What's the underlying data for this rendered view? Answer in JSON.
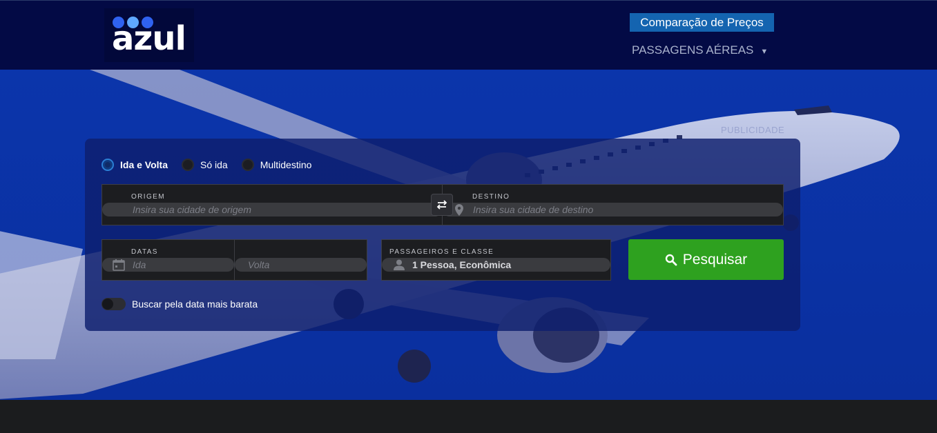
{
  "header": {
    "logo": {
      "text": "azul",
      "dot_colors": [
        "#2f62f0",
        "#5fa8ff",
        "#2f62f0"
      ]
    },
    "compare_label": "Comparação de Preços",
    "nav_label": "PASSAGENS AÉREAS",
    "nav_caret": "▼"
  },
  "hero": {
    "ad_label": "PUBLICIDADE"
  },
  "search": {
    "trip_types": [
      "Ida e Volta",
      "Só ida",
      "Multidestino"
    ],
    "selected_trip": "Ida e Volta",
    "origin": {
      "label": "ORIGEM",
      "placeholder": "Insira sua cidade de origem",
      "icon": "origin-circle-icon"
    },
    "destination": {
      "label": "DESTINO",
      "placeholder": "Insira sua cidade de destino",
      "icon": "map-pin-icon"
    },
    "swap_icon": "swap-arrows-icon",
    "dates": {
      "label": "DATAS",
      "depart_placeholder": "Ida",
      "return_placeholder": "Volta",
      "icon": "calendar-icon"
    },
    "passengers": {
      "label": "PASSAGEIROS E CLASSE",
      "value": "1 Pessoa, Econômica",
      "icon": "person-icon"
    },
    "search_button": "Pesquisar",
    "cheapest_toggle_label": "Buscar pela data mais barata",
    "cheapest_toggle_on": false
  },
  "colors": {
    "header_bg": "#030a45",
    "hero_bg": "#0a33a8",
    "compare_bg": "#1464b0",
    "search_button": "#2ea11f"
  }
}
